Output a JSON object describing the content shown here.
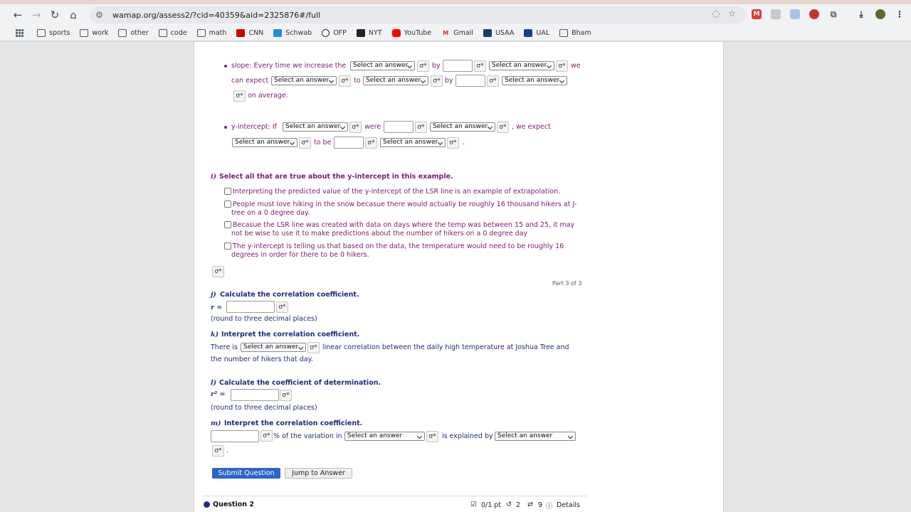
{
  "browser": {
    "url": "wamap.org/assess2/?cid=40359&aid=2325876#/full",
    "bookmarks": [
      "sports",
      "work",
      "other",
      "code",
      "math",
      "CNN",
      "Schwab",
      "OFP",
      "NYT",
      "YouTube",
      "Gmail",
      "USAA",
      "UAL",
      "Bham"
    ]
  },
  "select_placeholder": "Select an answer",
  "pen_glyph": "σ*",
  "slope": {
    "t1": "slope: Every time we increase the",
    "by": "by",
    "we": "we",
    "can_expect": "can expect",
    "to": "to",
    "by2": "by",
    "on_average": "on average."
  },
  "intercept": {
    "t1": "y-intercept: If",
    "were": "were",
    "we_expect": ", we expect",
    "to_be": "to be",
    "period": "."
  },
  "part_i": {
    "letter": "i)",
    "question": "Select all that are true about the y-intercept in this example.",
    "options": [
      [
        "Interpreting the predicted value of the y-intercept of the LSR line is an example of extrapolation."
      ],
      [
        "People must love hiking in the snow becasue there would actually be roughly 16 thousand hikers at J-",
        "tree on a 0 degree day."
      ],
      [
        "Becasue the LSR line was created with data on days where the temp was between 15 and 25, it may",
        "not be wise to use it to make predictions about the number of hikers on a 0 degree day"
      ],
      [
        "The y-intercept is telling us that based on the data, the temperature would need to be roughly 16",
        "degrees in order for there to be 0 hikers."
      ]
    ]
  },
  "part_label": "Part 3 of 3",
  "part_j": {
    "letter": "j)",
    "question": "Calculate the correlation coefficient.",
    "var": "r =",
    "note": "(round to three decimal places)"
  },
  "part_k": {
    "letter": "k)",
    "question": "Interpret the correlation coefficient.",
    "pre": "There is",
    "post": "linear correlation between the daily high temperature at Joshua Tree and",
    "line2": "the number of hikers that day."
  },
  "part_l": {
    "letter": "l)",
    "question": "Calculate the coefficient of determination.",
    "var": "r² =",
    "note": "(round to three decimal places)"
  },
  "part_m": {
    "letter": "m)",
    "question": "Interpret the correlation coefficient.",
    "t1": "% of the variation in",
    "t2": "is explained by",
    "period": "."
  },
  "buttons": {
    "submit": "Submit Question",
    "jump": "Jump to Answer"
  },
  "footer": {
    "question": "Question 2",
    "points": "0/1 pt",
    "retries": "2",
    "attempts": "9",
    "details": "Details"
  }
}
